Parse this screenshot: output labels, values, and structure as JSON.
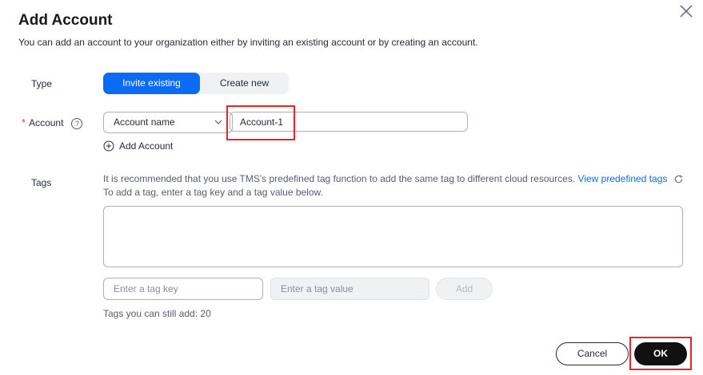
{
  "dialog": {
    "title": "Add Account",
    "description": "You can add an account to your organization either by inviting an existing account or by creating an account."
  },
  "type": {
    "label": "Type",
    "options": [
      "Invite existing",
      "Create new"
    ],
    "selected": "Invite existing"
  },
  "account": {
    "label": "Account",
    "select_value": "Account name",
    "input_value": "Account-1",
    "add_label": "Add Account"
  },
  "tags": {
    "label": "Tags",
    "hint_line1": "It is recommended that you use TMS's predefined tag function to add the same tag to different cloud resources.",
    "hint_link": "View predefined tags",
    "hint_line2": "To add a tag, enter a tag key and a tag value below.",
    "key_placeholder": "Enter a tag key",
    "value_placeholder": "Enter a tag value",
    "add_label": "Add",
    "remaining": "Tags you can still add: 20"
  },
  "footer": {
    "cancel_label": "Cancel",
    "ok_label": "OK"
  },
  "colors": {
    "accent": "#0a6cf5",
    "highlight": "#e8242b",
    "required": "#e54545"
  }
}
